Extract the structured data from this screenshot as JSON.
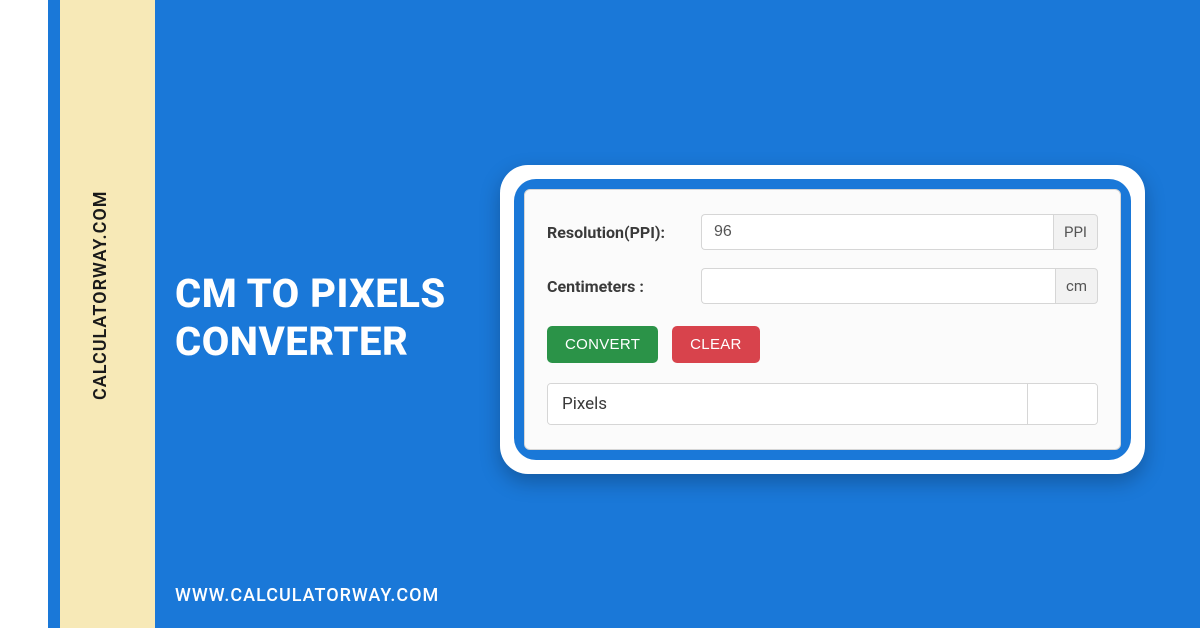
{
  "brand": {
    "vertical": "CALCULATORWAY.COM",
    "url": "WWW.CALCULATORWAY.COM"
  },
  "title": {
    "line1": "CM TO PIXELS",
    "line2": "CONVERTER"
  },
  "form": {
    "resolution": {
      "label": "Resolution(PPI):",
      "value": "96",
      "unit": "PPI"
    },
    "centimeters": {
      "label": "Centimeters :",
      "value": "",
      "unit": "cm"
    },
    "buttons": {
      "convert": "CONVERT",
      "clear": "CLEAR"
    },
    "result": {
      "label": "Pixels",
      "value": ""
    }
  }
}
